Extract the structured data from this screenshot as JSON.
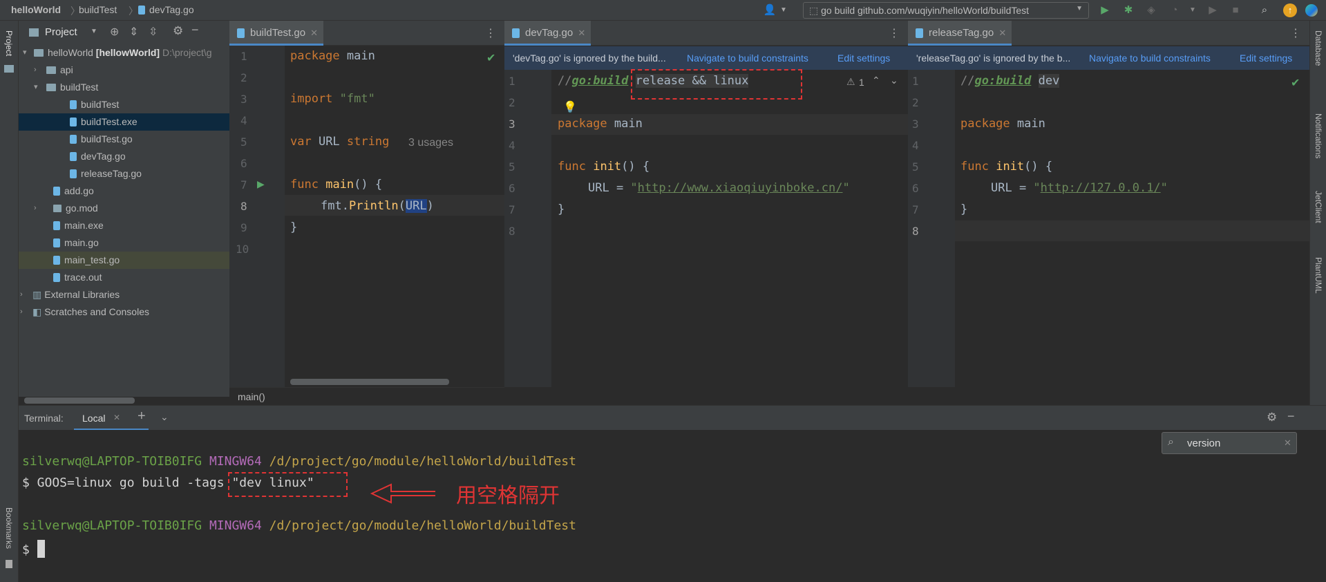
{
  "breadcrumb": {
    "project": "helloWorld",
    "folder": "buildTest",
    "file": "devTag.go"
  },
  "run_config": "go build github.com/wuqiyin/helloWorld/buildTest",
  "left_stripe": {
    "project": "Project",
    "bookmarks": "Bookmarks"
  },
  "right_stripe": {
    "database": "Database",
    "notifications": "Notifications",
    "jetclient": "JetClient",
    "plantuml": "PlantUML"
  },
  "project_panel": {
    "title": "Project",
    "tree": [
      {
        "label": "helloWorld",
        "bold": "[hellowWorld]",
        "path": "D:\\project\\g"
      },
      {
        "label": "api"
      },
      {
        "label": "buildTest"
      },
      {
        "label": "buildTest"
      },
      {
        "label": "buildTest.exe"
      },
      {
        "label": "buildTest.go"
      },
      {
        "label": "devTag.go"
      },
      {
        "label": "releaseTag.go"
      },
      {
        "label": "add.go"
      },
      {
        "label": "go.mod"
      },
      {
        "label": "main.exe"
      },
      {
        "label": "main.go"
      },
      {
        "label": "main_test.go"
      },
      {
        "label": "trace.out"
      },
      {
        "label": "External Libraries"
      },
      {
        "label": "Scratches and Consoles"
      }
    ]
  },
  "editors": {
    "left": {
      "tab": "buildTest.go",
      "line_numbers": [
        "1",
        "2",
        "3",
        "4",
        "5",
        "6",
        "7",
        "8",
        "9",
        "10"
      ],
      "usages": "3 usages",
      "status": "main()"
    },
    "middle": {
      "tab": "devTag.go",
      "notice": "'devTag.go' is ignored by the build...",
      "nav_link": "Navigate to build constraints",
      "edit_link": "Edit settings",
      "line_numbers": [
        "1",
        "2",
        "3",
        "4",
        "5",
        "6",
        "7",
        "8"
      ],
      "warning_count": "1",
      "url": "http://www.xiaoqiuyinboke.cn/"
    },
    "right": {
      "tab": "releaseTag.go",
      "notice": "'releaseTag.go' is ignored by the b...",
      "nav_link": "Navigate to build constraints",
      "edit_link": "Edit settings",
      "line_numbers": [
        "1",
        "2",
        "3",
        "4",
        "5",
        "6",
        "7",
        "8"
      ],
      "url": "http://127.0.0.1/"
    }
  },
  "terminal": {
    "label": "Terminal:",
    "tab": "Local",
    "search": "version",
    "prompt_user": "silverwq@LAPTOP-TOIB0IFG",
    "prompt_env": "MINGW64",
    "prompt_path": "/d/project/go/module/helloWorld/buildTest",
    "command": "$ GOOS=linux go build -tags",
    "command_arg": "\"dev linux\"",
    "prompt_end": "$",
    "annotation": "用空格隔开"
  },
  "colors": {
    "accent": "#4a88c7",
    "annotation": "#e03434",
    "keyword": "#cc7832",
    "string": "#6a8759"
  }
}
